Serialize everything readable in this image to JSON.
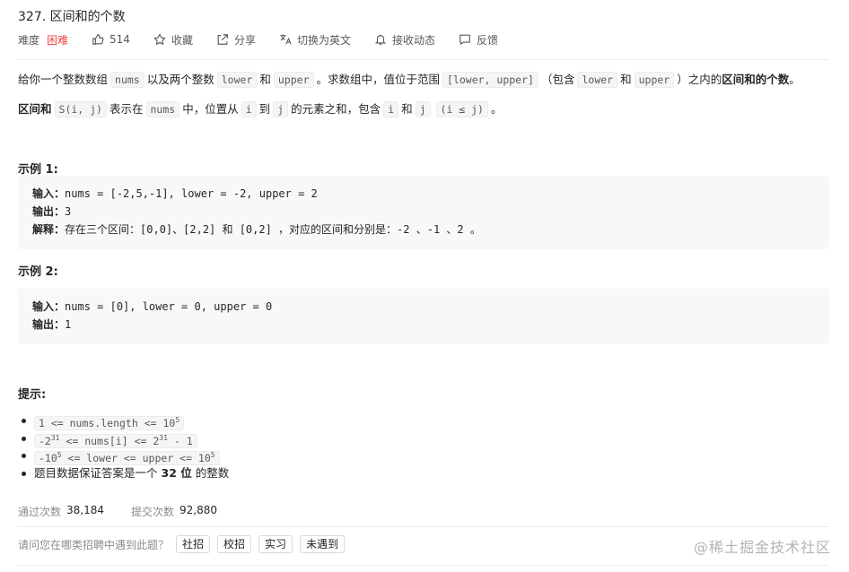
{
  "problem": {
    "title": "327. 区间和的个数"
  },
  "toolbar": {
    "difficulty_label": "难度",
    "difficulty_value": "困难",
    "likes": "514",
    "favorite": "收藏",
    "share": "分享",
    "switch_lang": "切换为英文",
    "subscribe": "接收动态",
    "feedback": "反馈"
  },
  "description": {
    "p1_a": "给你一个整数数组",
    "p1_code_nums": "nums",
    "p1_b": "以及两个整数",
    "p1_code_lower": "lower",
    "p1_c": "和",
    "p1_code_upper": "upper",
    "p1_d": "。求数组中，值位于范围",
    "p1_code_range": "[lower, upper]",
    "p1_e": "（包含",
    "p1_code_lower2": "lower",
    "p1_f": "和",
    "p1_code_upper2": "upper",
    "p1_g": "）之内的",
    "p1_bold": "区间和的个数",
    "p1_h": "。",
    "p2_bold": "区间和",
    "p2_code_s": "S(i, j)",
    "p2_a": "表示在",
    "p2_code_nums": "nums",
    "p2_b": "中，位置从",
    "p2_code_i": "i",
    "p2_c": "到",
    "p2_code_j": "j",
    "p2_d": "的元素之和，包含",
    "p2_code_i2": "i",
    "p2_e": "和",
    "p2_code_j2": "j",
    "p2_code_cond": "(i ≤ j)",
    "p2_f": "。"
  },
  "examples": [
    {
      "heading": "示例 1:",
      "input_label": "输入：",
      "input_value": "nums = [-2,5,-1], lower = -2, upper = 2",
      "output_label": "输出：",
      "output_value": "3",
      "explain_label": "解释：",
      "explain_value": "存在三个区间：[0,0]、[2,2] 和 [0,2] ，对应的区间和分别是：-2 、-1 、2 。"
    },
    {
      "heading": "示例 2:",
      "input_label": "输入：",
      "input_value": "nums = [0], lower = 0, upper = 0",
      "output_label": "输出：",
      "output_value": "1"
    }
  ],
  "hints": {
    "heading": "提示:",
    "h1_a": "1 <= nums.length <= 10",
    "h1_sup": "5",
    "h2_a": "-2",
    "h2_sup1": "31",
    "h2_b": " <= nums[i] <= 2",
    "h2_sup2": "31",
    "h2_c": " - 1",
    "h3_a": "-10",
    "h3_sup1": "5",
    "h3_b": " <= lower <= upper <= 10",
    "h3_sup2": "5",
    "h4_a": "题目数据保证答案是一个",
    "h4_bold": "32 位",
    "h4_b": "的整数"
  },
  "stats": {
    "accepted_label": "通过次数",
    "accepted_value": "38,184",
    "submissions_label": "提交次数",
    "submissions_value": "92,880"
  },
  "survey": {
    "question": "请问您在哪类招聘中遇到此题？",
    "options": [
      "社招",
      "校招",
      "实习",
      "未遇到"
    ]
  },
  "watermark": "@稀土掘金技术社区",
  "colors": {
    "hard": "#ef4743",
    "code_bg": "#f5f5f5",
    "pre_bg": "#f7f8fa"
  }
}
